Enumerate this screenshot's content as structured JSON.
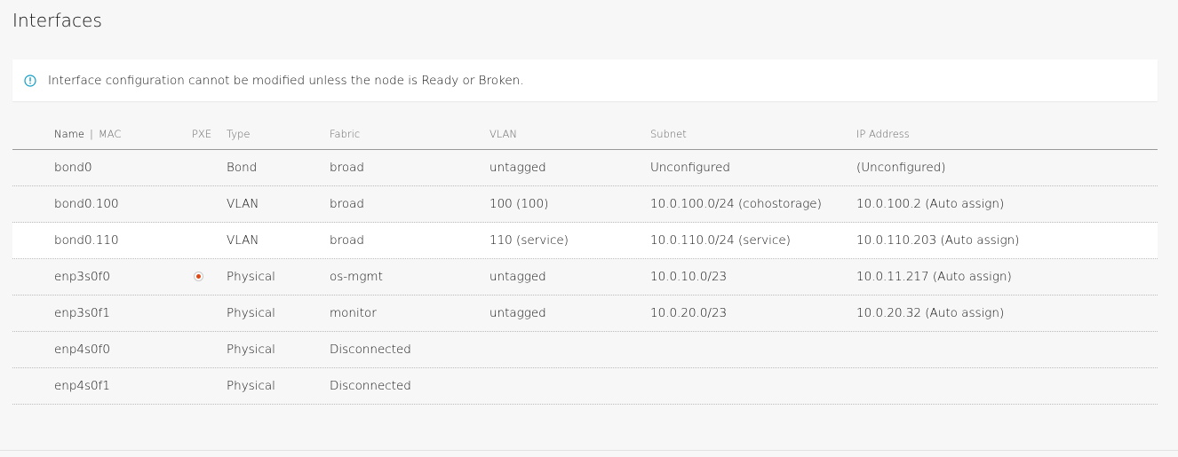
{
  "page": {
    "title": "Interfaces"
  },
  "notice": {
    "icon": "info-icon",
    "text": "Interface configuration cannot be modified unless the node is Ready or Broken.",
    "accent_color": "#0e9dc7"
  },
  "table": {
    "headers": {
      "name": "Name",
      "separator": "|",
      "mac": "MAC",
      "pxe": "PXE",
      "type": "Type",
      "fabric": "Fabric",
      "vlan": "VLAN",
      "subnet": "Subnet",
      "ip": "IP Address"
    },
    "rows": [
      {
        "name": "bond0",
        "pxe": false,
        "type": "Bond",
        "fabric": "broad",
        "vlan": "untagged",
        "subnet": "Unconfigured",
        "ip": "(Unconfigured)"
      },
      {
        "name": "bond0.100",
        "pxe": false,
        "type": "VLAN",
        "fabric": "broad",
        "vlan": "100 (100)",
        "subnet": "10.0.100.0/24 (cohostorage)",
        "ip": "10.0.100.2 (Auto assign)"
      },
      {
        "name": "bond0.110",
        "pxe": false,
        "type": "VLAN",
        "fabric": "broad",
        "vlan": "110 (service)",
        "subnet": "10.0.110.0/24 (service)",
        "ip": "10.0.110.203 (Auto assign)"
      },
      {
        "name": "enp3s0f0",
        "pxe": true,
        "type": "Physical",
        "fabric": "os-mgmt",
        "vlan": "untagged",
        "subnet": "10.0.10.0/23",
        "ip": "10.0.11.217 (Auto assign)"
      },
      {
        "name": "enp3s0f1",
        "pxe": false,
        "type": "Physical",
        "fabric": "monitor",
        "vlan": "untagged",
        "subnet": "10.0.20.0/23",
        "ip": "10.0.20.32 (Auto assign)"
      },
      {
        "name": "enp4s0f0",
        "pxe": false,
        "type": "Physical",
        "fabric": "Disconnected",
        "vlan": "",
        "subnet": "",
        "ip": ""
      },
      {
        "name": "enp4s0f1",
        "pxe": false,
        "type": "Physical",
        "fabric": "Disconnected",
        "vlan": "",
        "subnet": "",
        "ip": ""
      }
    ],
    "pxe_color": "#dd4814"
  }
}
